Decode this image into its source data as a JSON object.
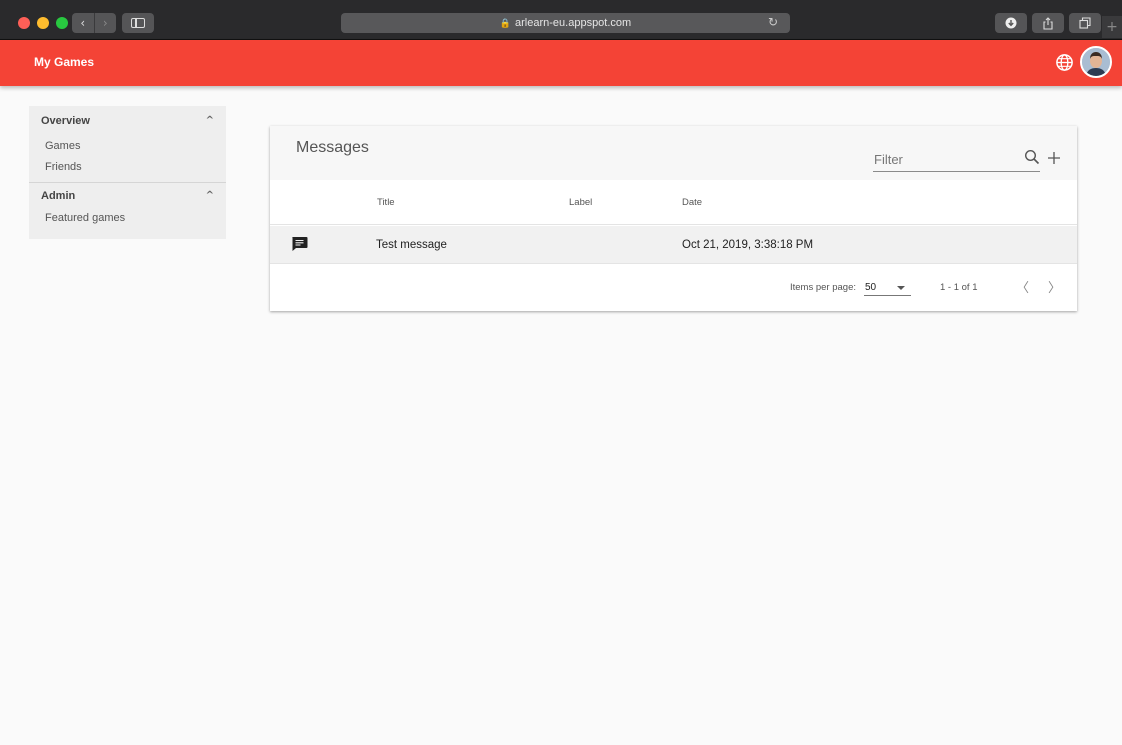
{
  "browser": {
    "url": "arlearn-eu.appspot.com",
    "back_glyph": "‹",
    "forward_glyph": "›",
    "reload_glyph": "↻",
    "lock_glyph": "🔒",
    "new_tab_glyph": "+",
    "toolbar_icons": [
      "download-icon",
      "share-icon",
      "tabs-icon"
    ]
  },
  "appbar": {
    "title": "My Games",
    "color": "#f44336",
    "icons": [
      "language-globe-icon",
      "user-avatar"
    ]
  },
  "nav": {
    "sections": [
      {
        "title": "Overview",
        "chevron": "^",
        "items": [
          "Games",
          "Friends"
        ]
      },
      {
        "title": "Admin",
        "chevron": "^",
        "items": [
          "Featured games"
        ]
      }
    ]
  },
  "messages": {
    "title": "Messages",
    "filter_placeholder": "Filter",
    "columns": [
      "Title",
      "Label",
      "Date"
    ],
    "rows": [
      {
        "icon": "message-icon",
        "title": "Test message",
        "label": "",
        "date": "Oct 21, 2019, 3:38:18 PM"
      }
    ],
    "paginator": {
      "items_per_page_label": "Items per page:",
      "items_per_page_value": "50",
      "range": "1 - 1 of 1",
      "prev_glyph": "〈",
      "next_glyph": "〉"
    }
  }
}
